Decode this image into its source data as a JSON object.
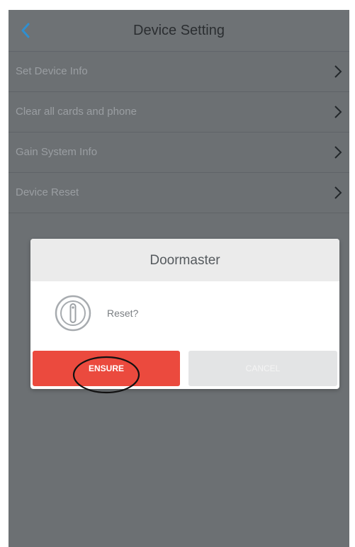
{
  "header": {
    "title": "Device Setting",
    "back_icon": "chevron-left-icon"
  },
  "menu": {
    "items": [
      {
        "label": "Set Device Info",
        "icon": "chevron-right-icon"
      },
      {
        "label": "Clear all cards and phone",
        "icon": "chevron-right-icon"
      },
      {
        "label": "Gain System Info",
        "icon": "chevron-right-icon"
      },
      {
        "label": "Device Reset",
        "icon": "chevron-right-icon"
      }
    ]
  },
  "dialog": {
    "title": "Doormaster",
    "message": "Reset?",
    "icon": "info-icon",
    "ensure_label": "ENSURE",
    "cancel_label": "CANCEL"
  },
  "colors": {
    "background": "#6c7073",
    "accent_back": "#2f8fd0",
    "ensure_button": "#eb4a3e",
    "cancel_button": "#e3e4e5",
    "annotation": "#111111"
  }
}
